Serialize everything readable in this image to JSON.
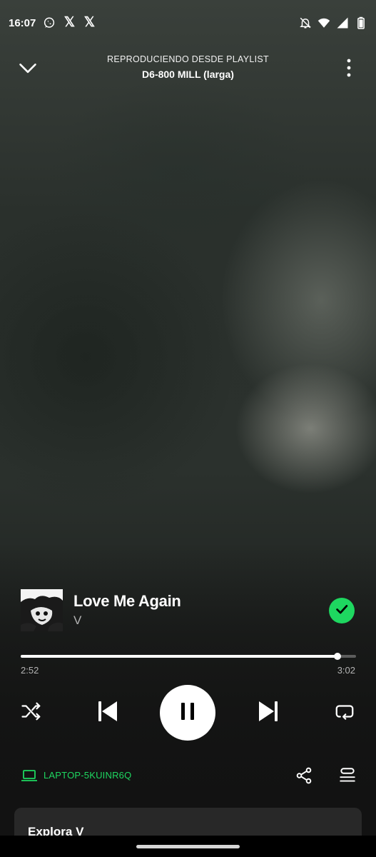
{
  "status_bar": {
    "time": "16:07",
    "app_icons": [
      "whatsapp-icon",
      "x-icon",
      "x-icon"
    ],
    "system_icons": [
      "bell-off-icon",
      "wifi-icon",
      "signal-icon",
      "battery-icon"
    ]
  },
  "header": {
    "context_label": "REPRODUCIENDO DESDE PLAYLIST",
    "context_name": "D6-800 MILL (larga)"
  },
  "track": {
    "title": "Love Me Again",
    "artist": "V",
    "saved": true
  },
  "playback": {
    "elapsed": "2:52",
    "total": "3:02",
    "progress_fraction": 0.945,
    "state": "playing"
  },
  "device": {
    "name": "LAPTOP-5KUINR6Q"
  },
  "explore": {
    "title": "Explora V"
  },
  "colors": {
    "accent": "#1ed760",
    "background": "#121212",
    "secondary_text": "#b3b3b3"
  }
}
